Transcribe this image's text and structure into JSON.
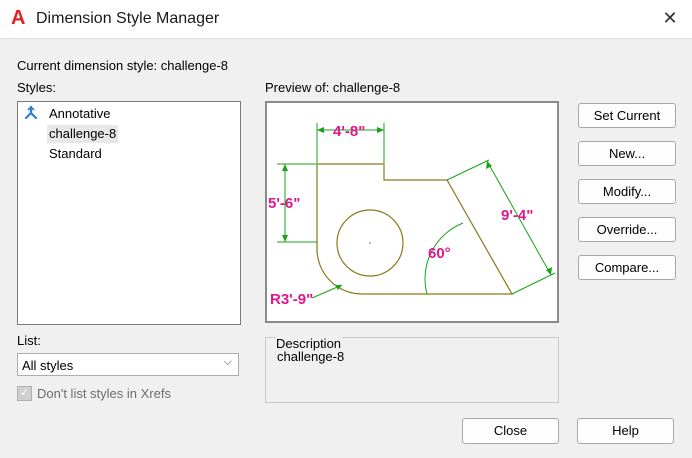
{
  "window": {
    "title": "Dimension Style Manager",
    "close_glyph": "✕"
  },
  "current_style": {
    "label": "Current dimension style: challenge-8"
  },
  "styles": {
    "label": "Styles:",
    "items": [
      {
        "name": "Annotative",
        "icon": "annotative-icon"
      },
      {
        "name": "challenge-8",
        "selected": true
      },
      {
        "name": "Standard"
      }
    ]
  },
  "preview": {
    "label": "Preview of: challenge-8",
    "dimensions": {
      "top_width": "4'-8\"",
      "left_height": "5'-6\"",
      "slant_length": "9'-4\"",
      "angle": "60°",
      "radius": "R3'-9\""
    }
  },
  "description": {
    "label": "Description",
    "text": "challenge-8"
  },
  "list": {
    "label": "List:",
    "selected": "All styles"
  },
  "xrefs_checkbox": {
    "label": "Don't list styles in Xrefs",
    "checked": true,
    "enabled": false
  },
  "buttons": {
    "set_current": "Set Current",
    "new": "New...",
    "modify": "Modify...",
    "override": "Override...",
    "compare": "Compare...",
    "close": "Close",
    "help": "Help"
  },
  "colors": {
    "dimension_text": "#e0188f",
    "dimension_lines": "#1aa31a",
    "geometry": "#8a7a1a",
    "app_icon": "#e02424"
  }
}
